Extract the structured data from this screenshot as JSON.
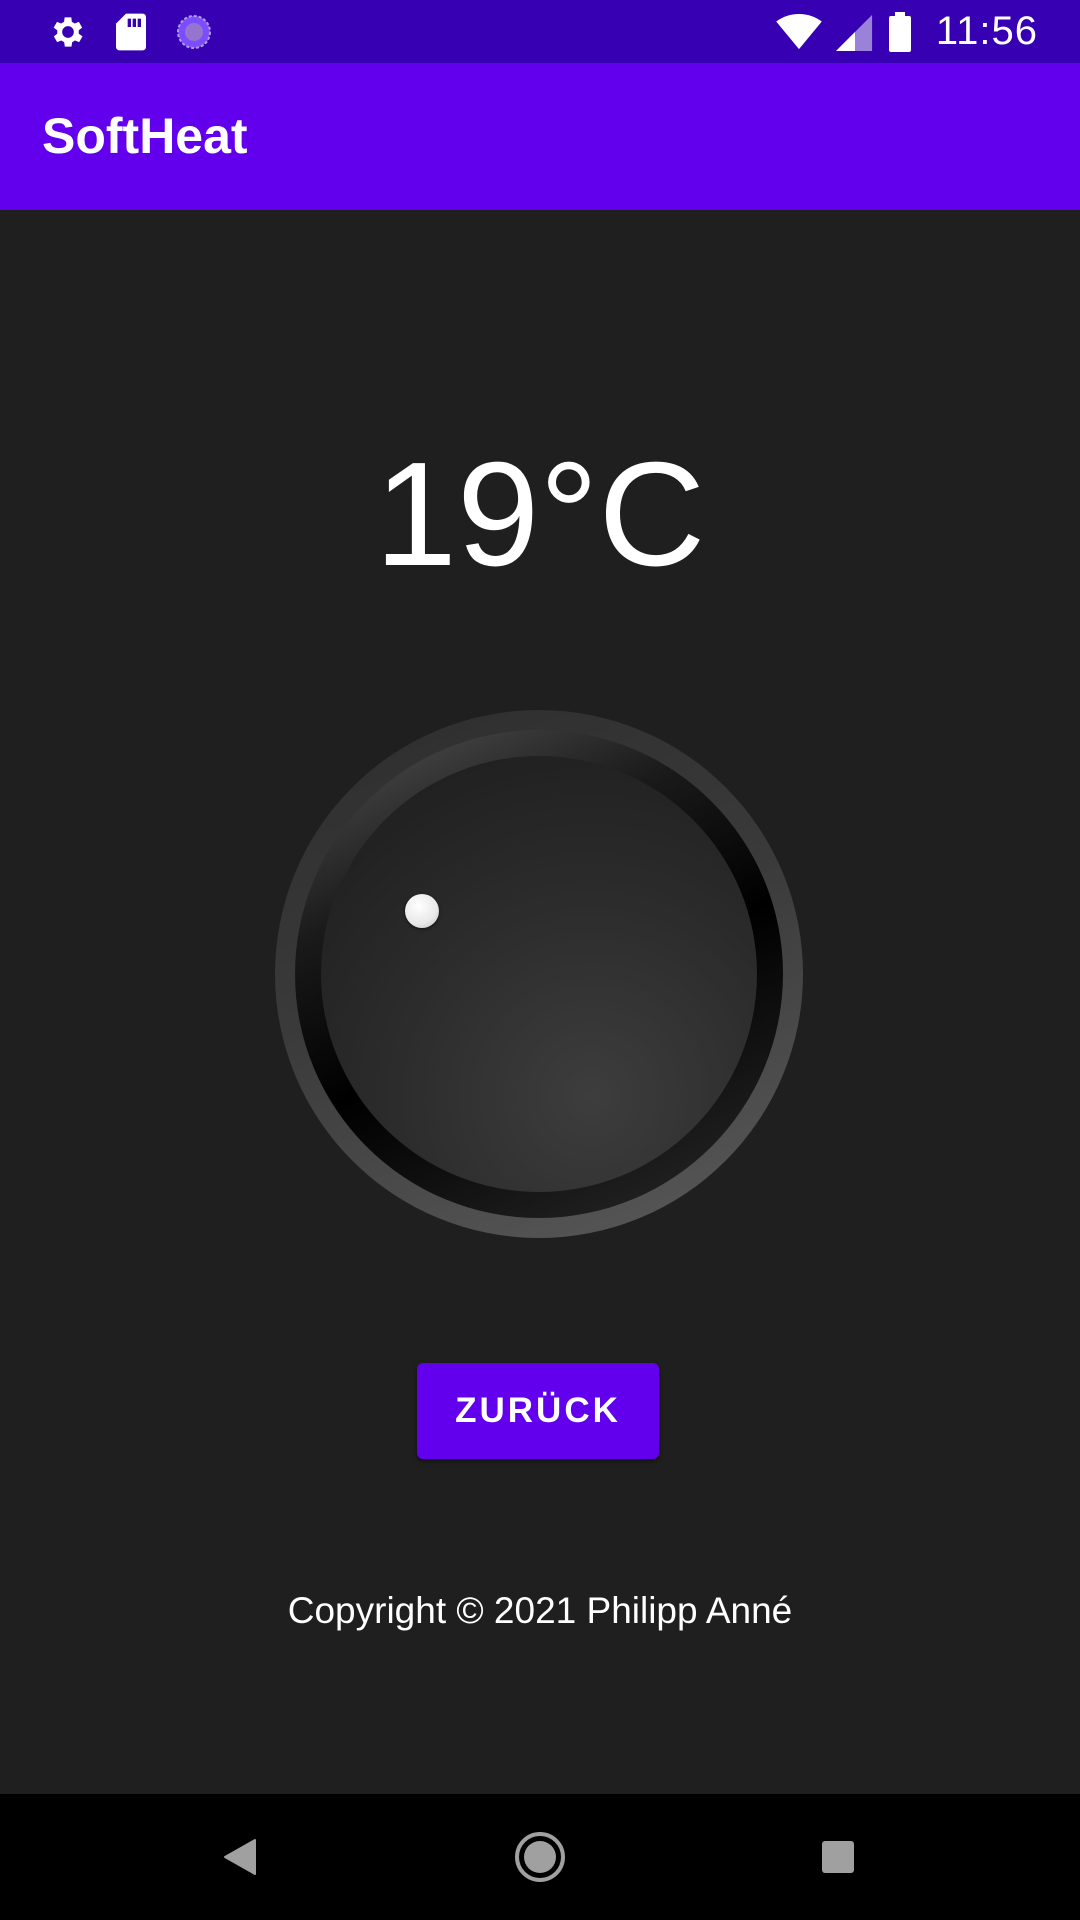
{
  "status_bar": {
    "time": "11:56",
    "left_icons": [
      "settings-icon",
      "sd-card-icon",
      "sync-icon"
    ],
    "right_icons": [
      "wifi-icon",
      "cell-signal-icon",
      "battery-icon"
    ]
  },
  "app_bar": {
    "title": "SoftHeat"
  },
  "thermostat": {
    "temperature_label": "19°C",
    "knob_icon": "knob-icon"
  },
  "actions": {
    "back_label": "ZURÜCK"
  },
  "footer": {
    "copyright": "Copyright © 2021 Philipp Anné"
  },
  "nav_bar": {
    "icons": [
      "back-triangle-icon",
      "home-circle-icon",
      "recents-square-icon"
    ]
  },
  "colors": {
    "primary": "#6200ee",
    "primary_dark": "#3700b3",
    "background": "#1f1f1f"
  }
}
